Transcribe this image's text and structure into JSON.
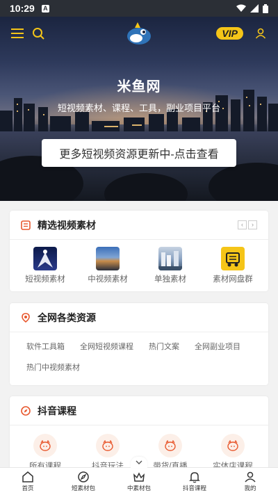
{
  "status_bar": {
    "time": "10:29",
    "badge": "A"
  },
  "hero": {
    "title": "米鱼网",
    "subtitle": "短视频素材、课程、工具，副业项目平台",
    "cta": "更多短视频资源更新中-点击查看",
    "vip": "VIP"
  },
  "featured": {
    "title": "精选视频素材",
    "items": [
      {
        "label": "短视频素材"
      },
      {
        "label": "中视频素材"
      },
      {
        "label": "单独素材"
      },
      {
        "label": "素材网盘群"
      }
    ]
  },
  "resources": {
    "title": "全网各类资源",
    "tags": [
      "软件工具箱",
      "全网短视频课程",
      "热门文案",
      "全网副业项目",
      "热门中视频素材"
    ]
  },
  "douyin": {
    "title": "抖音课程",
    "items": [
      {
        "label": "所有课程"
      },
      {
        "label": "抖音玩法"
      },
      {
        "label": "带货/直播"
      },
      {
        "label": "实体店课程"
      }
    ]
  },
  "bottom_nav": [
    {
      "label": "首页"
    },
    {
      "label": "短素材包"
    },
    {
      "label": "中素材包"
    },
    {
      "label": "抖音课程"
    },
    {
      "label": "我的"
    }
  ],
  "colors": {
    "accent": "#e8572c",
    "vip": "#f5c518"
  }
}
